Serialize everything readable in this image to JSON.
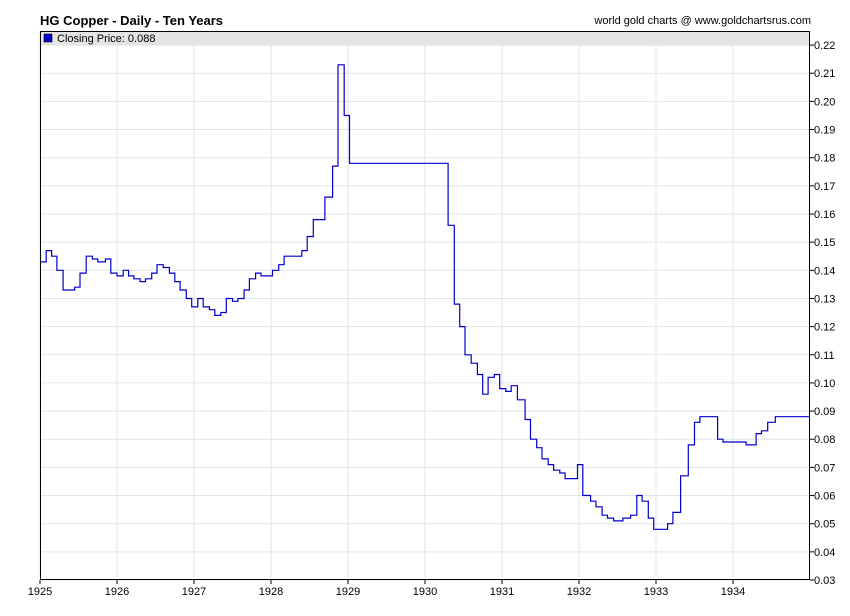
{
  "header": {
    "title": "HG Copper - Daily - Ten Years",
    "credit": "world gold charts @ www.goldchartsrus.com"
  },
  "legend": {
    "label": "Closing Price: 0.088",
    "color": "#0000cc"
  },
  "chart_data": {
    "type": "line",
    "title": "HG Copper - Daily - Ten Years",
    "xlabel": "",
    "ylabel": "",
    "xlim": [
      1925.0,
      1935.0
    ],
    "ylim": [
      0.03,
      0.225
    ],
    "x_ticks": [
      "1925",
      "1926",
      "1927",
      "1928",
      "1929",
      "1930",
      "1931",
      "1932",
      "1933",
      "1934"
    ],
    "y_ticks": [
      "0.03",
      "0.04",
      "0.05",
      "0.06",
      "0.07",
      "0.08",
      "0.09",
      "0.10",
      "0.11",
      "0.12",
      "0.13",
      "0.14",
      "0.15",
      "0.16",
      "0.17",
      "0.18",
      "0.19",
      "0.20",
      "0.21",
      "0.22"
    ],
    "grid": true,
    "legend_position": "top-left",
    "line_color": "#0000cc",
    "series": [
      {
        "name": "Closing Price",
        "step": true,
        "x": [
          1925.0,
          1925.08,
          1925.15,
          1925.22,
          1925.3,
          1925.45,
          1925.52,
          1925.6,
          1925.68,
          1925.75,
          1925.85,
          1925.92,
          1926.0,
          1926.08,
          1926.15,
          1926.22,
          1926.3,
          1926.37,
          1926.45,
          1926.52,
          1926.6,
          1926.68,
          1926.75,
          1926.82,
          1926.9,
          1926.97,
          1927.05,
          1927.12,
          1927.2,
          1927.27,
          1927.35,
          1927.42,
          1927.5,
          1927.57,
          1927.65,
          1927.72,
          1927.8,
          1927.87,
          1927.95,
          1928.02,
          1928.1,
          1928.17,
          1928.25,
          1928.32,
          1928.4,
          1928.47,
          1928.55,
          1928.62,
          1928.7,
          1928.8,
          1928.87,
          1928.95,
          1929.02,
          1929.1,
          1929.17,
          1929.23,
          1929.32,
          1929.4,
          1930.3,
          1930.38,
          1930.45,
          1930.52,
          1930.6,
          1930.68,
          1930.75,
          1930.82,
          1930.9,
          1930.97,
          1931.05,
          1931.12,
          1931.2,
          1931.3,
          1931.37,
          1931.45,
          1931.52,
          1931.6,
          1931.67,
          1931.75,
          1931.82,
          1931.9,
          1931.98,
          1932.05,
          1932.15,
          1932.22,
          1932.3,
          1932.37,
          1932.45,
          1932.57,
          1932.67,
          1932.75,
          1932.82,
          1932.9,
          1932.97,
          1933.05,
          1933.15,
          1933.22,
          1933.32,
          1933.42,
          1933.5,
          1933.57,
          1933.65,
          1933.8,
          1933.87,
          1934.05,
          1934.17,
          1934.3,
          1934.37,
          1934.45,
          1934.55,
          1935.0
        ],
        "y": [
          0.143,
          0.147,
          0.145,
          0.14,
          0.133,
          0.134,
          0.139,
          0.145,
          0.144,
          0.143,
          0.144,
          0.139,
          0.138,
          0.14,
          0.138,
          0.137,
          0.136,
          0.137,
          0.139,
          0.142,
          0.141,
          0.139,
          0.136,
          0.133,
          0.13,
          0.127,
          0.13,
          0.127,
          0.126,
          0.124,
          0.125,
          0.13,
          0.129,
          0.13,
          0.133,
          0.137,
          0.139,
          0.138,
          0.138,
          0.14,
          0.142,
          0.145,
          0.145,
          0.145,
          0.147,
          0.152,
          0.158,
          0.158,
          0.166,
          0.177,
          0.213,
          0.195,
          0.178,
          0.178,
          0.178,
          0.178,
          0.178,
          0.178,
          0.156,
          0.128,
          0.12,
          0.11,
          0.107,
          0.103,
          0.096,
          0.102,
          0.103,
          0.098,
          0.097,
          0.099,
          0.094,
          0.087,
          0.08,
          0.077,
          0.073,
          0.071,
          0.069,
          0.068,
          0.066,
          0.066,
          0.071,
          0.06,
          0.058,
          0.056,
          0.053,
          0.052,
          0.051,
          0.052,
          0.053,
          0.06,
          0.058,
          0.052,
          0.048,
          0.048,
          0.05,
          0.054,
          0.067,
          0.078,
          0.086,
          0.088,
          0.088,
          0.08,
          0.079,
          0.079,
          0.078,
          0.082,
          0.083,
          0.086,
          0.088,
          0.088
        ]
      }
    ]
  }
}
